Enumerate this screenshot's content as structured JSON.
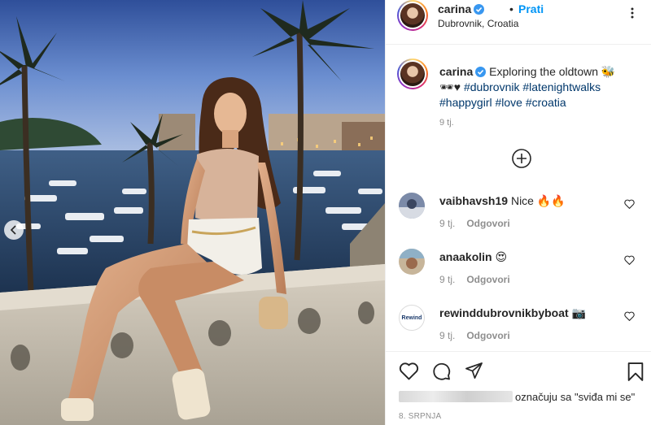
{
  "post": {
    "username": "carina",
    "follow_label": "Prati",
    "separator": "•",
    "location": "Dubrovnik, Croatia",
    "caption": {
      "username": "carina",
      "text": "Exploring the oldtown",
      "emoji_1": "🐝",
      "emoji_2": "🕶♥",
      "tags": [
        "#dubrovnik",
        "#latenightwalks",
        "#happygirl",
        "#love",
        "#croatia"
      ],
      "time": "9 tj."
    }
  },
  "comments": [
    {
      "username": "vaibhavsh19",
      "text": "Nice 🔥🔥",
      "time": "9 tj.",
      "reply_label": "Odgovori"
    },
    {
      "username": "anaakolin",
      "text": "😍",
      "time": "9 tj.",
      "reply_label": "Odgovori"
    },
    {
      "username": "rewinddubrovnikbyboat",
      "text": "📷",
      "time": "9 tj.",
      "reply_label": "Odgovori",
      "avatar_text": "Rewind"
    }
  ],
  "footer": {
    "likes_text": "označuju sa \"sviđa mi se\"",
    "date": "8. SRPNJA"
  },
  "colors": {
    "accent": "#0095f6",
    "hashtag": "#00376b",
    "muted": "#8e8e8e",
    "border": "#efefef"
  },
  "icons": [
    "verified-badge-icon",
    "more-options-icon",
    "load-more-icon",
    "heart-icon",
    "comment-icon",
    "share-icon",
    "save-icon",
    "carousel-prev-icon"
  ]
}
